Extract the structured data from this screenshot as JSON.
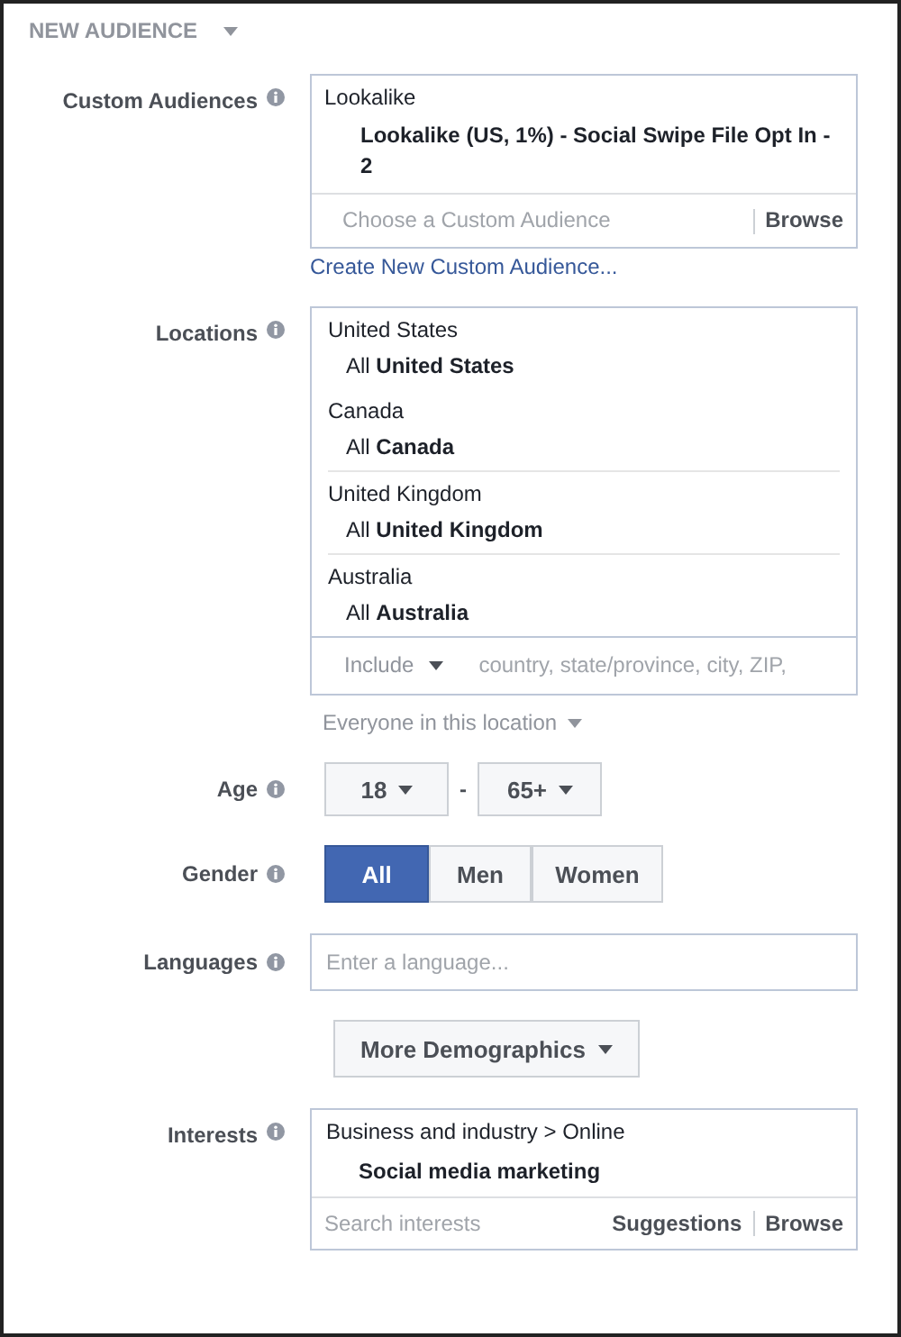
{
  "header": {
    "title": "NEW AUDIENCE"
  },
  "custom_audiences": {
    "label": "Custom Audiences",
    "group": "Lookalike",
    "items": [
      "Lookalike (US, 1%) - Social Swipe File Opt In - 2"
    ],
    "placeholder": "Choose a Custom Audience",
    "browse": "Browse",
    "create_link": "Create New Custom Audience..."
  },
  "locations": {
    "label": "Locations",
    "items": [
      {
        "country": "United States",
        "detail": "All **United States**"
      },
      {
        "country": "Canada",
        "detail": "All **Canada**"
      },
      {
        "country": "United Kingdom",
        "detail": "All **United Kingdom**"
      },
      {
        "country": "Australia",
        "detail": "All **Australia**"
      }
    ],
    "include": "Include",
    "placeholder": "country, state/province, city, ZIP,",
    "scope": "Everyone in this location"
  },
  "age": {
    "label": "Age",
    "from": "18",
    "separator": "-",
    "to": "65+"
  },
  "gender": {
    "label": "Gender",
    "options": [
      {
        "label": "All",
        "selected": true
      },
      {
        "label": "Men",
        "selected": false
      },
      {
        "label": "Women",
        "selected": false
      }
    ]
  },
  "languages": {
    "label": "Languages",
    "placeholder": "Enter a language..."
  },
  "more_demographics": "More Demographics",
  "interests": {
    "label": "Interests",
    "group": "Business and industry > Online",
    "items": [
      "Social media marketing"
    ],
    "placeholder": "Search interests",
    "suggestions": "Suggestions",
    "browse": "Browse"
  }
}
